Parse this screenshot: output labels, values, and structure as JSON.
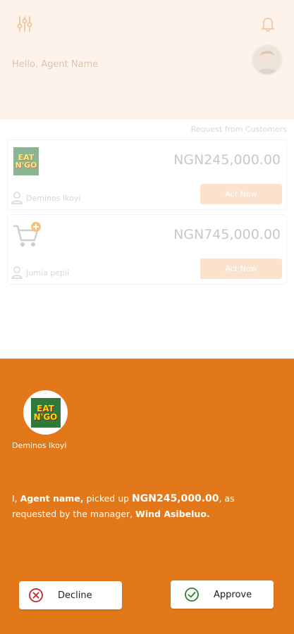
{
  "header": {
    "greeting": "Hello, Agent Name"
  },
  "requests": {
    "section_title": "Request from Customers",
    "items": [
      {
        "logo_lines": [
          "EAT",
          "N'GO"
        ],
        "amount": "NGN245,000.00",
        "location": "Deminos Ikoyi",
        "action_label": "Act Now"
      },
      {
        "amount": "NGN745,000.00",
        "location": "Jumia pepii",
        "action_label": "Act Now"
      }
    ]
  },
  "sheet": {
    "merchant": {
      "logo_lines": [
        "EAT",
        "N'GO"
      ],
      "name": "Deminos Ikoyi"
    },
    "message": {
      "prefix": "I, ",
      "agent": "Agent name,",
      "middle": " picked up ",
      "amount": "NGN245,000.00",
      "suffix": ", as requested by the manager, ",
      "manager": "Wind Asibeluo."
    },
    "decline_label": "Decline",
    "approve_label": "Approve"
  },
  "colors": {
    "accent": "#e3781b",
    "header_bg": "#fdf3ea",
    "decline_icon": "#c62828",
    "approve_icon": "#2e7d32"
  }
}
